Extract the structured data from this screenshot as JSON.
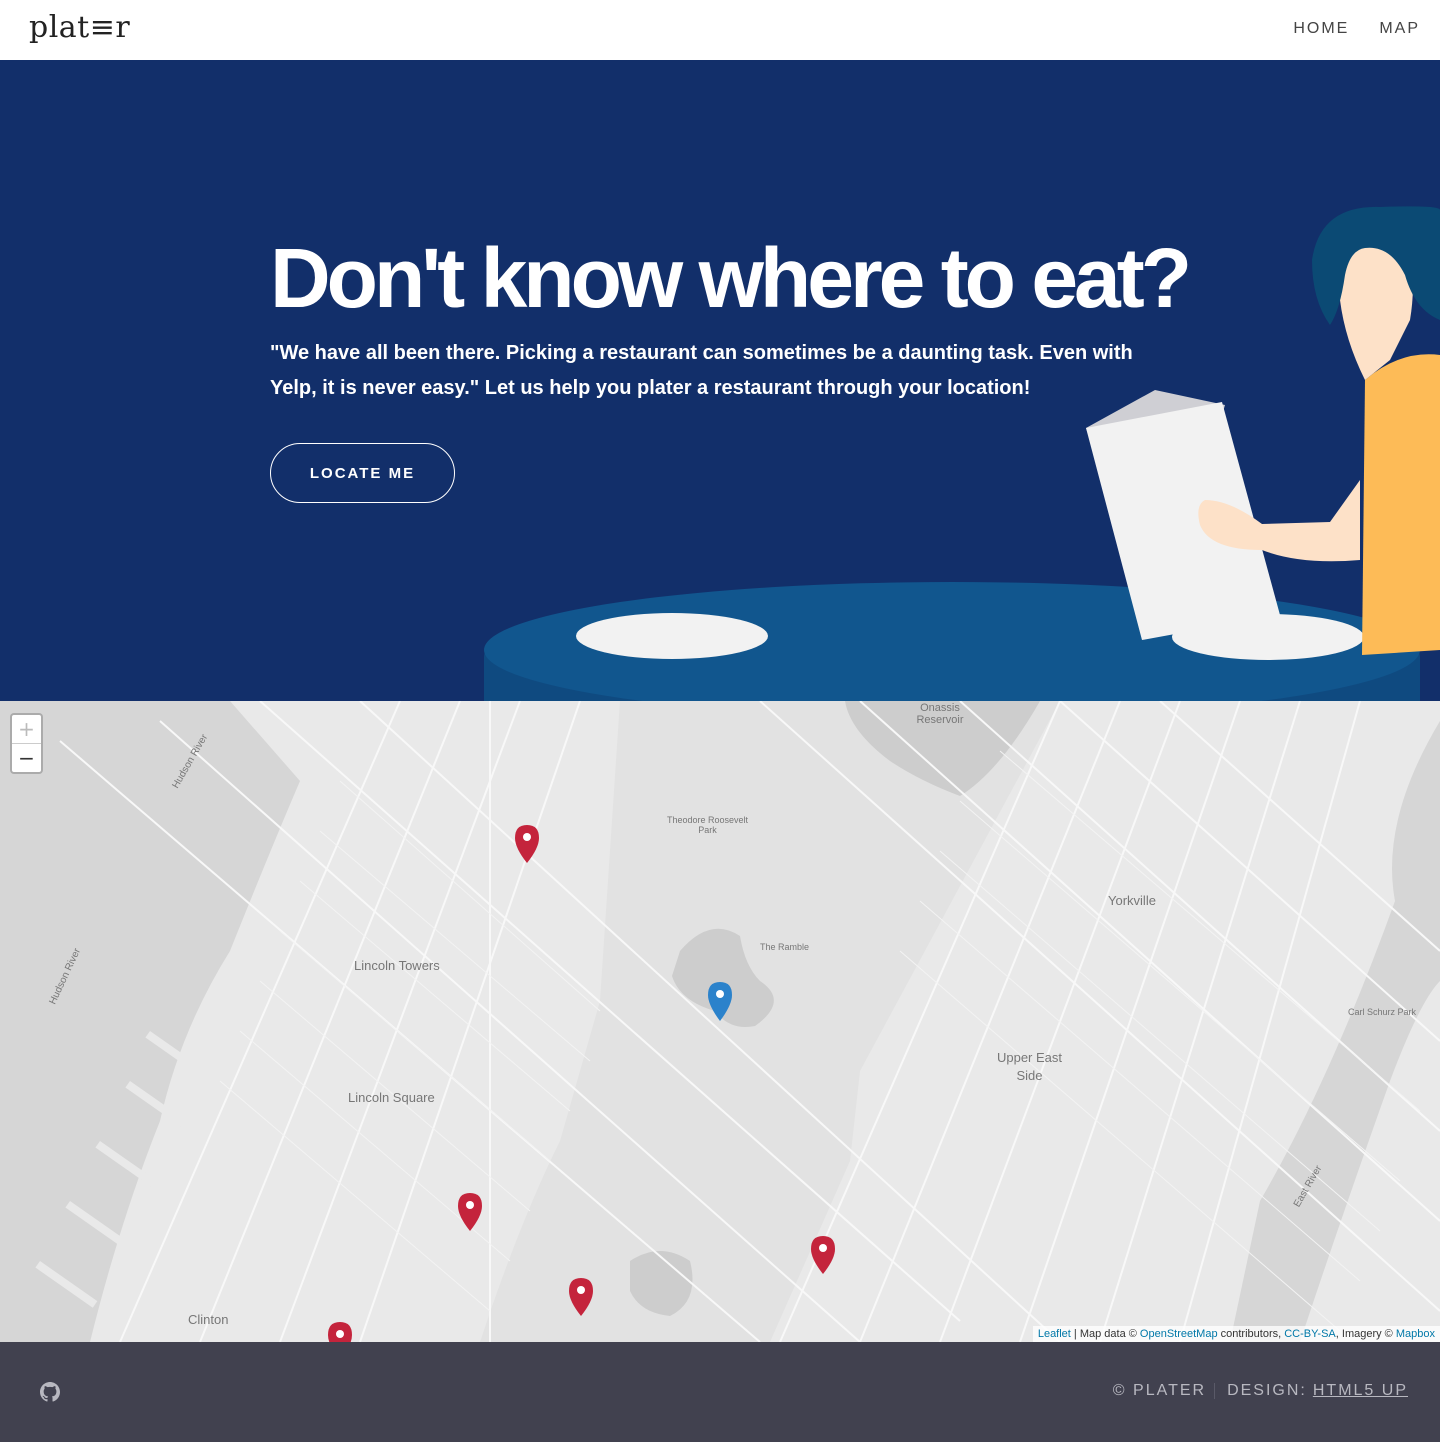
{
  "header": {
    "logo": "plat≡r",
    "nav": [
      {
        "label": "HOME"
      },
      {
        "label": "MAP"
      }
    ]
  },
  "hero": {
    "title": "Don't know where to eat?",
    "text": "\"We have all been there. Picking a restaurant can sometimes be a daunting task. Even with Yelp, it is never easy.\" Let us help you plater a restaurant through your location!",
    "button_label": "LOCATE ME"
  },
  "map": {
    "zoom_in": "+",
    "zoom_out": "−",
    "labels": {
      "onassis": "Onassis Reservoir",
      "roosevelt": "Theodore Roosevelt Park",
      "ramble": "The Ramble",
      "yorkville": "Yorkville",
      "lincoln_towers": "Lincoln Towers",
      "lincoln_square": "Lincoln Square",
      "ues": "Upper East Side",
      "clinton": "Clinton",
      "carl_schurz": "Carl Schurz Park",
      "hudson1": "Hudson River",
      "hudson2": "Hudson River",
      "east_river": "East River"
    },
    "attribution": {
      "leaflet": "Leaflet",
      "map_data": " | Map data © ",
      "osm": "OpenStreetMap",
      "contributors": " contributors, ",
      "license": "CC-BY-SA",
      "imagery": ", Imagery © ",
      "mapbox": "Mapbox"
    },
    "marker_colors": {
      "restaurant": "#c4243c",
      "user": "#2b82cb"
    }
  },
  "footer": {
    "copyright": "© PLATER",
    "design_label": "DESIGN:",
    "design_link": "HTML5 UP"
  },
  "colors": {
    "hero_bg": "#122f6a",
    "footer_bg": "#41414f",
    "table": "#11568e"
  }
}
